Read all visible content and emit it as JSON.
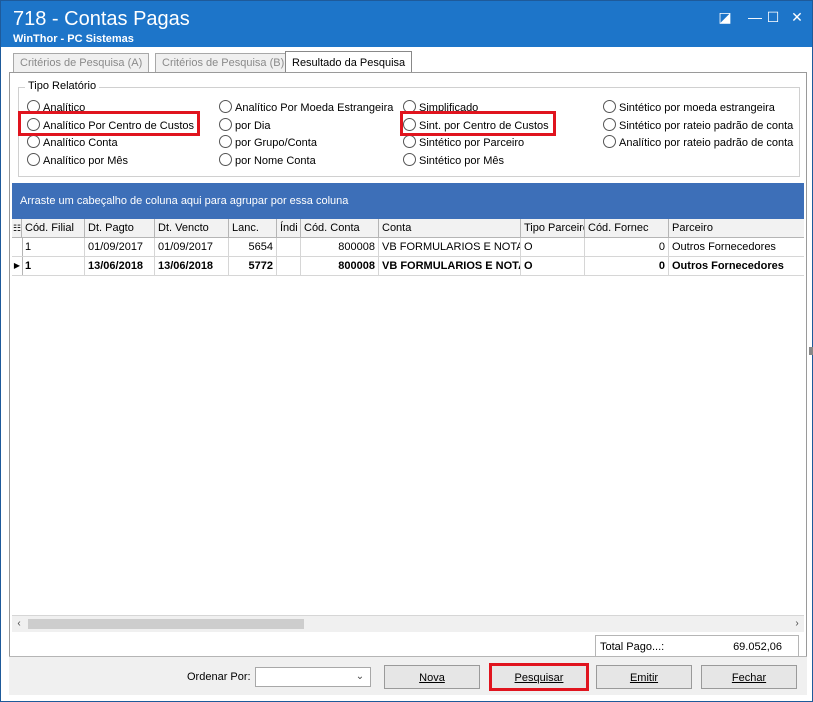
{
  "window": {
    "title": "718 - Contas Pagas",
    "subtitle": "WinThor - PC Sistemas",
    "min_glyph": "◪",
    "max_glyph": "☐",
    "close_glyph": "✕"
  },
  "tabs": [
    {
      "label": "Critérios de Pesquisa (A)",
      "active": false
    },
    {
      "label": "Critérios de Pesquisa (B)",
      "active": false
    },
    {
      "label": "Resultado da Pesquisa",
      "active": true
    }
  ],
  "report_type": {
    "label": "Tipo Relatório",
    "options": [
      "Analítico",
      "Analítico Por Centro de Custos",
      "Analítico Conta",
      "Analítico por Mês",
      "Analítico Por Moeda Estrangeira",
      "por Dia",
      "por Grupo/Conta",
      "por Nome Conta",
      "Simplificado",
      "Sint. por Centro de Custos",
      "Sintético por Parceiro",
      "Sintético por Mês",
      "Sintético por moeda estrangeira",
      "Sintético por rateio padrão de conta",
      "Analítico por rateio padrão de conta"
    ]
  },
  "grid": {
    "group_hint": "Arraste um cabeçalho de coluna aqui para agrupar por essa coluna",
    "columns": [
      "Cód. Filial",
      "Dt. Pagto",
      "Dt. Vencto",
      "Lanc.",
      "Índi",
      "Cód. Conta",
      "Conta",
      "Tipo Parceiro",
      "Cód. Fornec",
      "Parceiro"
    ],
    "rows": [
      [
        "1",
        "01/09/2017",
        "01/09/2017",
        "5654",
        "",
        "800008",
        "VB FORMULARIOS E NOTAS",
        "O",
        "0",
        "Outros Fornecedores"
      ],
      [
        "1",
        "13/06/2018",
        "13/06/2018",
        "5772",
        "",
        "800008",
        "VB FORMULARIOS E NOTAS",
        "O",
        "0",
        "Outros Fornecedores"
      ]
    ],
    "selected_row_marker": "▶",
    "column_menu_glyph": "☷",
    "scroll_left": "‹",
    "scroll_right": "›"
  },
  "totals": {
    "label": "Total Pago...:",
    "value": "69.052,06"
  },
  "footer": {
    "order_label": "Ordenar Por:",
    "order_value": "",
    "chevron": "⌄",
    "buttons": {
      "nova": "Nova",
      "pesquisar": "Pesquisar",
      "emitir": "Emitir",
      "fechar": "Fechar"
    }
  }
}
